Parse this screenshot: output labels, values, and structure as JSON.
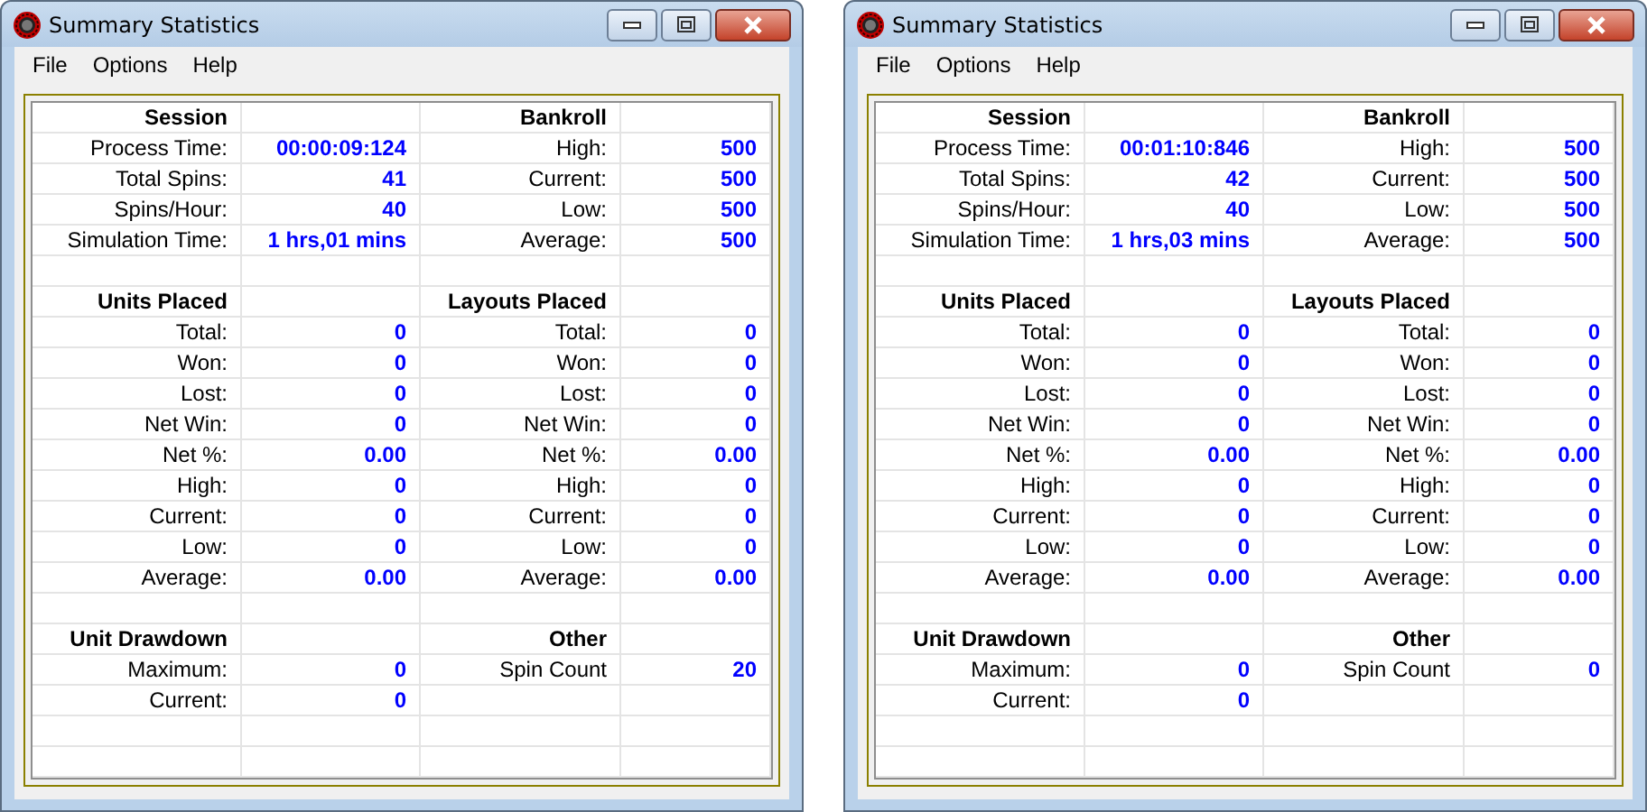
{
  "windows": [
    {
      "title": "Summary Statistics",
      "menu": [
        "File",
        "Options",
        "Help"
      ],
      "rows": [
        {
          "kind": "header",
          "left": {
            "label": "Session"
          },
          "right": {
            "label": "Bankroll"
          }
        },
        {
          "kind": "data",
          "left": {
            "label": "Process Time:",
            "value": "00:00:09:124"
          },
          "right": {
            "label": "High:",
            "value": "500"
          }
        },
        {
          "kind": "data",
          "left": {
            "label": "Total Spins:",
            "value": "41"
          },
          "right": {
            "label": "Current:",
            "value": "500"
          }
        },
        {
          "kind": "data",
          "left": {
            "label": "Spins/Hour:",
            "value": "40"
          },
          "right": {
            "label": "Low:",
            "value": "500"
          }
        },
        {
          "kind": "data",
          "left": {
            "label": "Simulation Time:",
            "value": "1 hrs,01 mins"
          },
          "right": {
            "label": "Average:",
            "value": "500"
          }
        },
        {
          "kind": "blank"
        },
        {
          "kind": "header",
          "left": {
            "label": "Units Placed"
          },
          "right": {
            "label": "Layouts Placed"
          }
        },
        {
          "kind": "data",
          "left": {
            "label": "Total:",
            "value": "0"
          },
          "right": {
            "label": "Total:",
            "value": "0"
          }
        },
        {
          "kind": "data",
          "left": {
            "label": "Won:",
            "value": "0"
          },
          "right": {
            "label": "Won:",
            "value": "0"
          }
        },
        {
          "kind": "data",
          "left": {
            "label": "Lost:",
            "value": "0"
          },
          "right": {
            "label": "Lost:",
            "value": "0"
          }
        },
        {
          "kind": "data",
          "left": {
            "label": "Net Win:",
            "value": "0"
          },
          "right": {
            "label": "Net Win:",
            "value": "0"
          }
        },
        {
          "kind": "data",
          "left": {
            "label": "Net %:",
            "value": "0.00"
          },
          "right": {
            "label": "Net %:",
            "value": "0.00"
          }
        },
        {
          "kind": "data",
          "left": {
            "label": "High:",
            "value": "0"
          },
          "right": {
            "label": "High:",
            "value": "0"
          }
        },
        {
          "kind": "data",
          "left": {
            "label": "Current:",
            "value": "0"
          },
          "right": {
            "label": "Current:",
            "value": "0"
          }
        },
        {
          "kind": "data",
          "left": {
            "label": "Low:",
            "value": "0"
          },
          "right": {
            "label": "Low:",
            "value": "0"
          }
        },
        {
          "kind": "data",
          "left": {
            "label": "Average:",
            "value": "0.00"
          },
          "right": {
            "label": "Average:",
            "value": "0.00"
          }
        },
        {
          "kind": "blank"
        },
        {
          "kind": "header",
          "left": {
            "label": "Unit Drawdown"
          },
          "right": {
            "label": "Other"
          }
        },
        {
          "kind": "data",
          "left": {
            "label": "Maximum:",
            "value": "0"
          },
          "right": {
            "label": "Spin Count",
            "value": "20"
          }
        },
        {
          "kind": "data",
          "left": {
            "label": "Current:",
            "value": "0"
          }
        },
        {
          "kind": "blank"
        },
        {
          "kind": "blank"
        }
      ]
    },
    {
      "title": "Summary Statistics",
      "menu": [
        "File",
        "Options",
        "Help"
      ],
      "rows": [
        {
          "kind": "header",
          "left": {
            "label": "Session"
          },
          "right": {
            "label": "Bankroll"
          }
        },
        {
          "kind": "data",
          "left": {
            "label": "Process Time:",
            "value": "00:01:10:846"
          },
          "right": {
            "label": "High:",
            "value": "500"
          }
        },
        {
          "kind": "data",
          "left": {
            "label": "Total Spins:",
            "value": "42"
          },
          "right": {
            "label": "Current:",
            "value": "500"
          }
        },
        {
          "kind": "data",
          "left": {
            "label": "Spins/Hour:",
            "value": "40"
          },
          "right": {
            "label": "Low:",
            "value": "500"
          }
        },
        {
          "kind": "data",
          "left": {
            "label": "Simulation Time:",
            "value": "1 hrs,03 mins"
          },
          "right": {
            "label": "Average:",
            "value": "500"
          }
        },
        {
          "kind": "blank"
        },
        {
          "kind": "header",
          "left": {
            "label": "Units Placed"
          },
          "right": {
            "label": "Layouts Placed"
          }
        },
        {
          "kind": "data",
          "left": {
            "label": "Total:",
            "value": "0"
          },
          "right": {
            "label": "Total:",
            "value": "0"
          }
        },
        {
          "kind": "data",
          "left": {
            "label": "Won:",
            "value": "0"
          },
          "right": {
            "label": "Won:",
            "value": "0"
          }
        },
        {
          "kind": "data",
          "left": {
            "label": "Lost:",
            "value": "0"
          },
          "right": {
            "label": "Lost:",
            "value": "0"
          }
        },
        {
          "kind": "data",
          "left": {
            "label": "Net Win:",
            "value": "0"
          },
          "right": {
            "label": "Net Win:",
            "value": "0"
          }
        },
        {
          "kind": "data",
          "left": {
            "label": "Net %:",
            "value": "0.00"
          },
          "right": {
            "label": "Net %:",
            "value": "0.00"
          }
        },
        {
          "kind": "data",
          "left": {
            "label": "High:",
            "value": "0"
          },
          "right": {
            "label": "High:",
            "value": "0"
          }
        },
        {
          "kind": "data",
          "left": {
            "label": "Current:",
            "value": "0"
          },
          "right": {
            "label": "Current:",
            "value": "0"
          }
        },
        {
          "kind": "data",
          "left": {
            "label": "Low:",
            "value": "0"
          },
          "right": {
            "label": "Low:",
            "value": "0"
          }
        },
        {
          "kind": "data",
          "left": {
            "label": "Average:",
            "value": "0.00"
          },
          "right": {
            "label": "Average:",
            "value": "0.00"
          }
        },
        {
          "kind": "blank"
        },
        {
          "kind": "header",
          "left": {
            "label": "Unit Drawdown"
          },
          "right": {
            "label": "Other"
          }
        },
        {
          "kind": "data",
          "left": {
            "label": "Maximum:",
            "value": "0"
          },
          "right": {
            "label": "Spin Count",
            "value": "0"
          }
        },
        {
          "kind": "data",
          "left": {
            "label": "Current:",
            "value": "0"
          }
        },
        {
          "kind": "blank"
        },
        {
          "kind": "blank"
        }
      ]
    }
  ]
}
